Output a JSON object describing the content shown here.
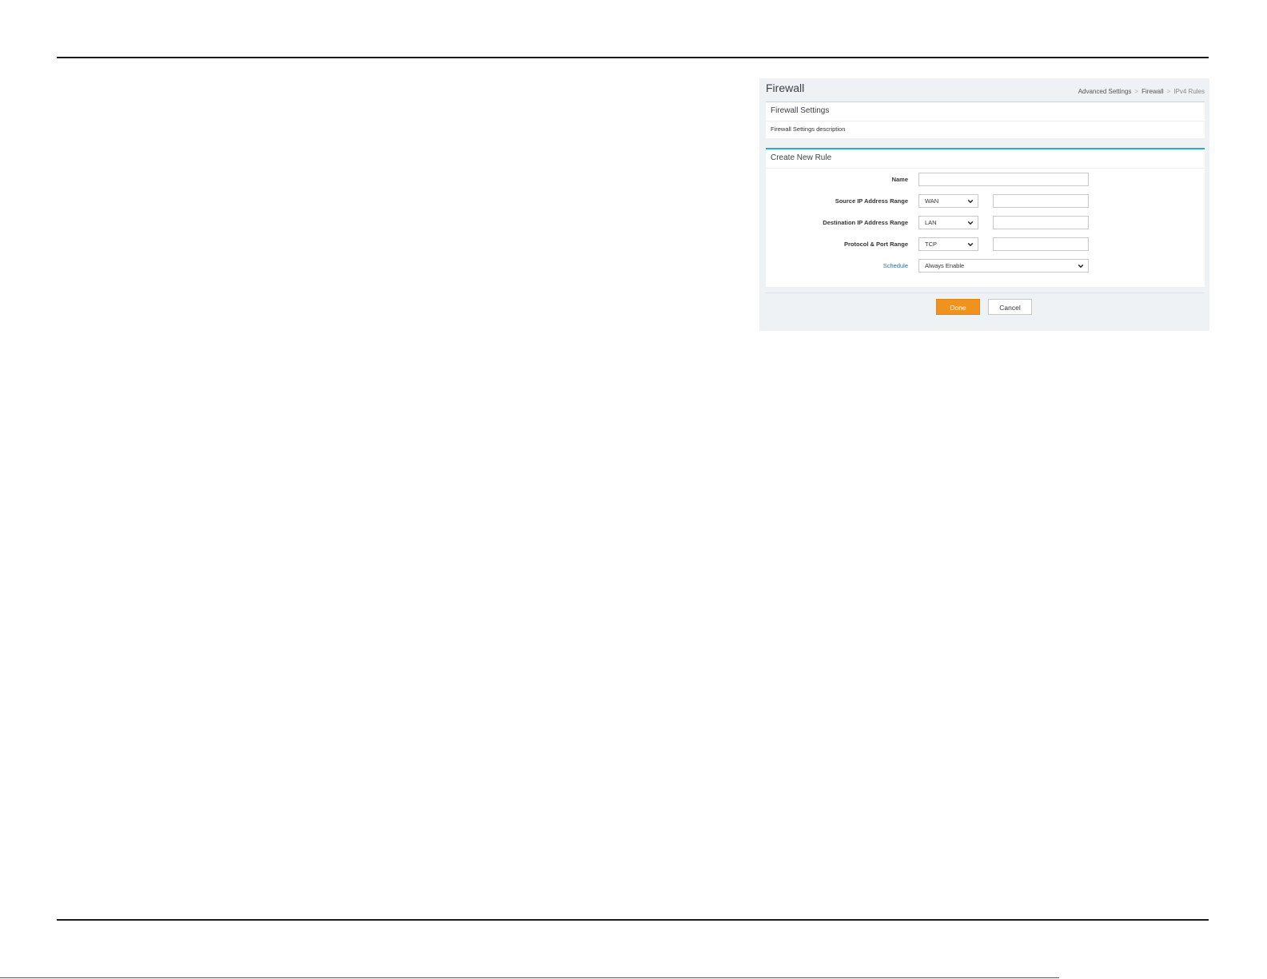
{
  "page": {
    "title": "Firewall",
    "breadcrumb": [
      "Advanced Settings",
      "Firewall",
      "IPv4 Rules"
    ],
    "breadcrumb_separator": ">"
  },
  "settings_panel": {
    "title": "Firewall Settings",
    "description": "Firewall Settings description"
  },
  "rule_panel": {
    "title": "Create New Rule",
    "fields": {
      "name": {
        "label": "Name",
        "value": ""
      },
      "source": {
        "label": "Source IP Address Range",
        "selected": "WAN",
        "value": ""
      },
      "destination": {
        "label": "Destination IP Address Range",
        "selected": "LAN",
        "value": ""
      },
      "protocol": {
        "label": "Protocol & Port Range",
        "selected": "TCP",
        "value": ""
      },
      "schedule": {
        "label": "Schedule",
        "selected": "Always Enable"
      }
    }
  },
  "buttons": {
    "done": "Done",
    "cancel": "Cancel"
  },
  "colors": {
    "accent_blue": "#2aa8d8",
    "done_orange": "#f0931e",
    "link_blue": "#2a6ea8",
    "panel_bg": "#eef2f5"
  },
  "icons": {
    "select_arrow": "chevron-down-icon"
  }
}
